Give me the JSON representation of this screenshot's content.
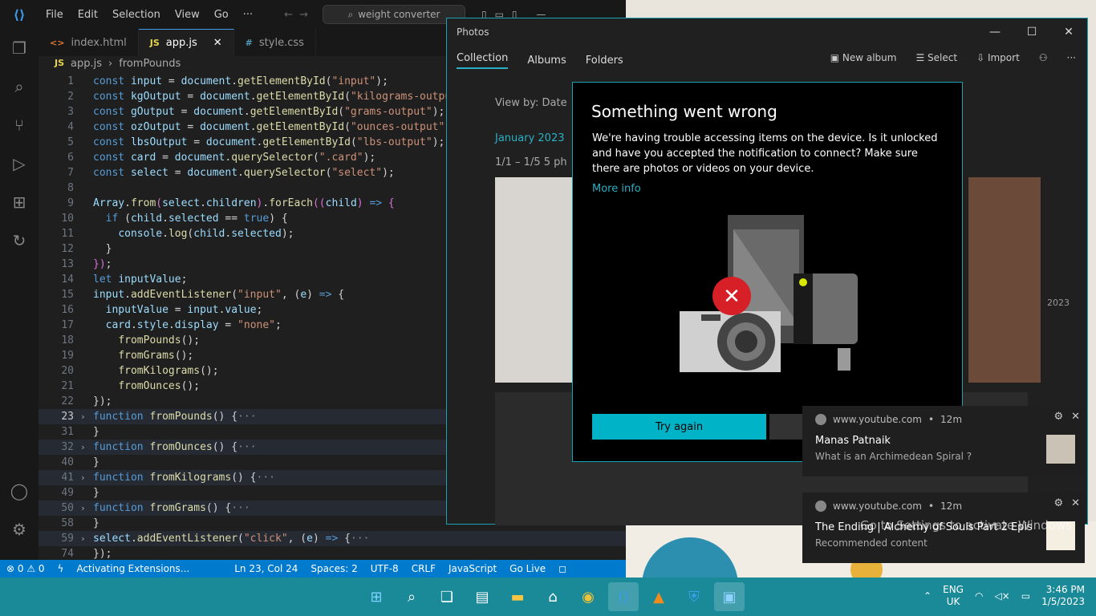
{
  "vscode": {
    "menu": [
      "File",
      "Edit",
      "Selection",
      "View",
      "Go"
    ],
    "search": "weight converter",
    "tabs": [
      {
        "icon": "<>",
        "label": "index.html"
      },
      {
        "icon": "JS",
        "label": "app.js"
      },
      {
        "icon": "#",
        "label": "style.css"
      }
    ],
    "breadcrumb": {
      "file": "app.js",
      "symbol": "fromPounds"
    },
    "status": {
      "problems": "⊗ 0 ⚠ 0",
      "activity": "Activating Extensions...",
      "position": "Ln 23, Col 24",
      "spaces": "Spaces: 2",
      "encoding": "UTF-8",
      "eol": "CRLF",
      "language": "JavaScript",
      "golive": "Go Live"
    }
  },
  "photos": {
    "title": "Photos",
    "nav": [
      "Collection",
      "Albums",
      "Folders"
    ],
    "actions": [
      "New album",
      "Select",
      "Import"
    ],
    "view_by": "View by:   Date",
    "month": "January 2023",
    "range": "1/1 – 1/5    5 ph",
    "year": "2023"
  },
  "dialog": {
    "title": "Something went wrong",
    "message": "We're having trouble accessing items on the device. Is it unlocked and have you accepted the notification to connect? Make sure there are photos or videos on your device.",
    "link": "More info",
    "try_again": "Try again"
  },
  "notifications": [
    {
      "source": "www.youtube.com",
      "time": "12m",
      "title": "Manas Patnaik",
      "body": "What is an Archimedean Spiral ?"
    },
    {
      "source": "www.youtube.com",
      "time": "12m",
      "title": "The Ending | Alchemy of Souls Part 2 Episode...",
      "body": "Recommended content"
    }
  ],
  "activate_windows": "Go to Settings to activate Windows",
  "tray": {
    "lang1": "ENG",
    "lang2": "UK",
    "time": "3:46 PM",
    "date": "1/5/2023"
  }
}
